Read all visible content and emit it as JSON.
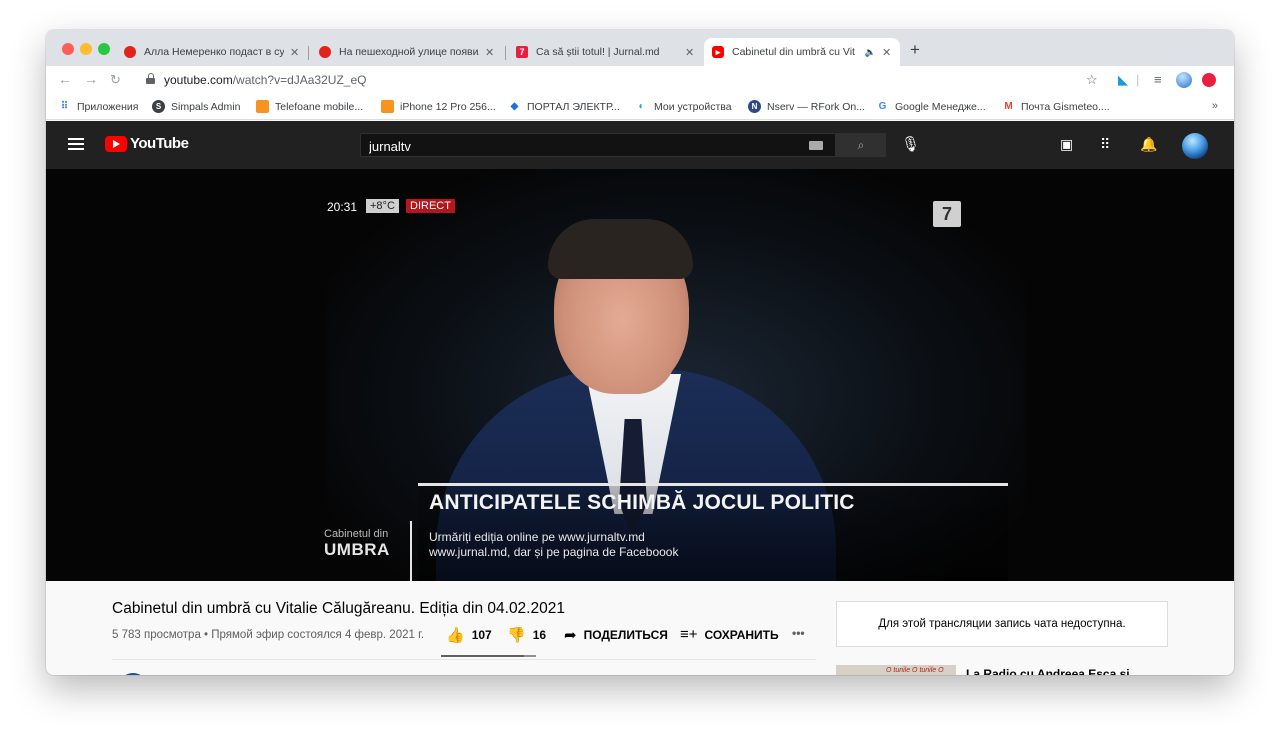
{
  "browser": {
    "tabs": [
      {
        "title": "Алла Немеренко подаст в суд",
        "favicon_color": "#e2231a"
      },
      {
        "title": "На пешеходной улице появил",
        "favicon_color": "#e2231a"
      },
      {
        "title": "Ca să știi totul! | Jurnal.md",
        "favicon_color": "#e8203d",
        "favicon_glyph": "7"
      },
      {
        "title": "Cabinetul din umbră cu Vit",
        "favicon_color": "#ff0000",
        "active": true
      }
    ],
    "address": {
      "domain": "youtube.com",
      "path": "/watch?v=dJAa32UZ_eQ"
    },
    "bookmarks": [
      {
        "label": "Приложения",
        "icon": "apps-grid-icon"
      },
      {
        "label": "Simpals Admin",
        "icon": "simpals-icon"
      },
      {
        "label": "Telefoane mobile...",
        "icon": "orange-square-icon"
      },
      {
        "label": "iPhone 12 Pro 256...",
        "icon": "orange-square-icon"
      },
      {
        "label": "ПОРТАЛ ЭЛЕКТР...",
        "icon": "portal-icon"
      },
      {
        "label": "Мои устройства",
        "icon": "devices-icon"
      },
      {
        "label": "Nserv — RFork On...",
        "icon": "nserv-icon"
      },
      {
        "label": "Google Менедже...",
        "icon": "google-icon"
      },
      {
        "label": "Почта Gismeteo....",
        "icon": "gmail-icon"
      }
    ],
    "bookmarks_more": "»"
  },
  "youtube": {
    "logo_text": "YouTube",
    "search_value": "jurnaltv"
  },
  "video": {
    "overlay_time": "20:31",
    "overlay_temp": "+8°C",
    "overlay_live": "DIRECT",
    "channel_logo": "7",
    "headline": "ANTICIPATELE SCHIMBĂ JOCUL POLITIC",
    "subline1": "Urmăriți ediția online pe www.jurnaltv.md",
    "subline2": "www.jurnal.md, dar și pe pagina de Faceboook",
    "brand_small": "Cabinetul din",
    "brand_big": "UMBRA"
  },
  "info": {
    "title": "Cabinetul din umbră cu Vitalie Călugăreanu. Ediția din 04.02.2021",
    "meta": "5 783 просмотра • Прямой эфир состоялся 4 февр. 2021 г.",
    "likes": "107",
    "dislikes": "16",
    "like_ratio": 0.87,
    "share_label": "ПОДЕЛИТЬСЯ",
    "save_label": "СОХРАНИТЬ",
    "more_label": "•••"
  },
  "chat": {
    "unavailable": "Для этой трансляции запись чата недоступна."
  },
  "recommended": {
    "title": "La Radio cu Andreea Esca și",
    "thumb_text": "O turiile O turiile O"
  }
}
